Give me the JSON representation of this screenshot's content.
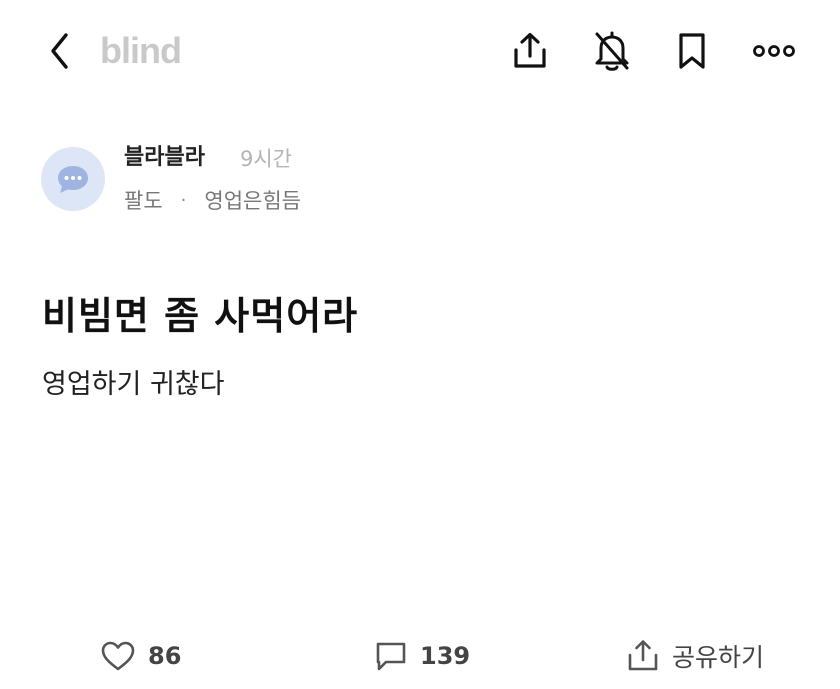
{
  "header": {
    "logo_text": "blind",
    "icons": {
      "back": "chevron-left-icon",
      "share": "share-upload-icon",
      "notifications": "bell-off-icon",
      "bookmark": "bookmark-icon",
      "more": "more-dots-icon"
    }
  },
  "author": {
    "name": "블라블라",
    "time": "9시간",
    "company": "팔도",
    "separator": "·",
    "topic": "영업은힘듬",
    "avatar_icon": "chat-bubble-avatar-icon",
    "avatar_color": "#dde6f6",
    "avatar_accent": "#9fb4e0"
  },
  "post": {
    "title": "비빔면 좀 사먹어라",
    "body": "영업하기 귀찮다"
  },
  "footer": {
    "like_count": "86",
    "comment_count": "139",
    "share_label": "공유하기",
    "icons": {
      "like": "heart-icon",
      "comment": "comment-icon",
      "share": "share-upload-icon"
    }
  },
  "colors": {
    "logo": "#c9c9c9",
    "icon_dark": "#111111",
    "footer_icon": "#555555",
    "muted_text": "#b4b4b4"
  }
}
